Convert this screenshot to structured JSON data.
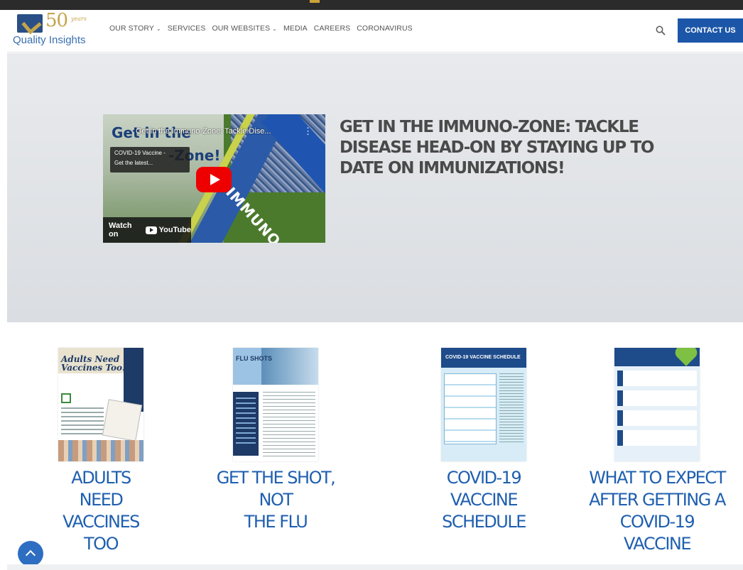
{
  "header": {
    "logo": {
      "number": "50",
      "tagline": "years",
      "name": "Quality Insights"
    },
    "nav": [
      {
        "label": "OUR STORY",
        "has_dropdown": true
      },
      {
        "label": "SERVICES",
        "has_dropdown": false
      },
      {
        "label": "OUR WEBSITES",
        "has_dropdown": true
      },
      {
        "label": "MEDIA",
        "has_dropdown": false
      },
      {
        "label": "CAREERS",
        "has_dropdown": false
      },
      {
        "label": "CORONAVIRUS",
        "has_dropdown": false
      }
    ],
    "search_icon": "search-icon",
    "contact_label": "CONTACT US"
  },
  "hero": {
    "video": {
      "title": "Get in the Immuno-Zone: Tackle Dise...",
      "overlay_line1": "Get in the",
      "overlay_line2": "-Zone!",
      "chip_line1": "COVID-19 Vaccine -",
      "chip_line2": "Get the latest...",
      "field_text": "IMMUNO-ZONE",
      "watch_label": "Watch on",
      "youtube_word": "YouTube"
    },
    "title": "GET IN THE IMMUNO-ZONE: TACKLE DISEASE HEAD-ON BY STAYING UP TO DATE ON IMMUNIZATIONS!"
  },
  "cards": [
    {
      "label_line1": "ADULTS NEED",
      "label_line2": "VACCINES TOO",
      "label_line3": "",
      "thumb_title": "Adults Need Vaccines Too!"
    },
    {
      "label_line1": "GET THE SHOT, NOT",
      "label_line2": "THE FLU",
      "label_line3": "",
      "thumb_title": "FLU SHOTS"
    },
    {
      "label_line1": "COVID-19 VACCINE",
      "label_line2": "SCHEDULE",
      "label_line3": "",
      "thumb_title": "COVID-19 VACCINE SCHEDULE"
    },
    {
      "label_line1": "WHAT TO EXPECT",
      "label_line2": "AFTER GETTING A",
      "label_line3": "COVID-19 VACCINE",
      "thumb_title": ""
    }
  ],
  "colors": {
    "brand_blue": "#1c56a8",
    "heading_blue": "#1f5fb0",
    "gold": "#c5a44a",
    "youtube_red": "#ee0000"
  },
  "scroll_top_icon": "chevron-up-icon"
}
